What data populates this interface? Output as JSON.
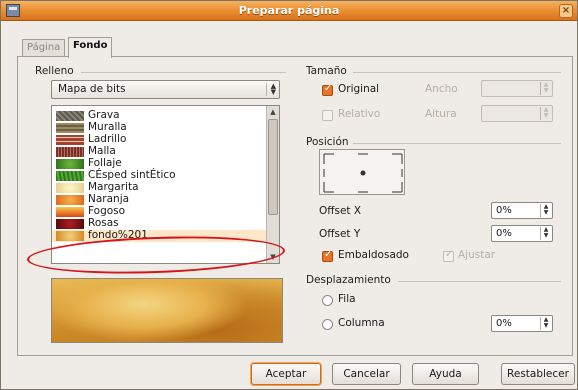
{
  "window": {
    "title": "Preparar página"
  },
  "tabs": [
    {
      "label": "Página",
      "active": false
    },
    {
      "label": "Fondo",
      "active": true
    }
  ],
  "relleno": {
    "group_label": "Relleno",
    "type_value": "Mapa de bits",
    "items": [
      {
        "label": "Grava",
        "swatch": "#6f6a5c"
      },
      {
        "label": "Muralla",
        "swatch": "#8b7a55"
      },
      {
        "label": "Ladrillo",
        "swatch": "#9a3b2c"
      },
      {
        "label": "Malla",
        "swatch": "#7a2f2a"
      },
      {
        "label": "Follaje",
        "swatch": "#3f8a2a"
      },
      {
        "label": "CÉsped sintÉtico",
        "swatch": "#2d7a1f"
      },
      {
        "label": "Margarita",
        "swatch": "#e8d9a4"
      },
      {
        "label": "Naranja",
        "swatch": "#e77b1c"
      },
      {
        "label": "Fogoso",
        "swatch": "#e0641b"
      },
      {
        "label": "Rosas",
        "swatch": "#7a1414"
      },
      {
        "label": "fondo%201",
        "swatch": "#e6a43c",
        "selected": true
      }
    ]
  },
  "tamano": {
    "group_label": "Tamaño",
    "original_label": "Original",
    "original_checked": true,
    "relativo_label": "Relativo",
    "relativo_checked": false,
    "ancho_label": "Ancho",
    "altura_label": "Altura"
  },
  "posicion": {
    "group_label": "Posición",
    "offset_x_label": "Offset X",
    "offset_x_value": "0%",
    "offset_y_label": "Offset Y",
    "offset_y_value": "0%",
    "embaldosado_label": "Embaldosado",
    "embaldosado_checked": true,
    "ajustar_label": "Ajustar",
    "ajustar_checked": true
  },
  "desplazamiento": {
    "group_label": "Desplazamiento",
    "fila_label": "Fila",
    "columna_label": "Columna",
    "value": "0%"
  },
  "buttons": {
    "accept": "Aceptar",
    "cancel": "Cancelar",
    "help": "Ayuda",
    "reset": "Restablecer"
  },
  "colors": {
    "titlebar": "#e98b2e",
    "accent": "#e8742a",
    "annotation": "#d8141b"
  }
}
